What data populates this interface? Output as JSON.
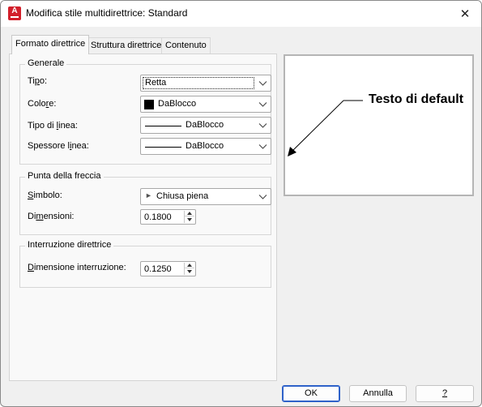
{
  "window": {
    "title": "Modifica stile multidirettrice: Standard",
    "app_icon_letter": "A",
    "close_glyph": "✕"
  },
  "tabs": [
    {
      "label": "Formato direttrice",
      "active": true
    },
    {
      "label": "Struttura direttrice",
      "active": false
    },
    {
      "label": "Contenuto",
      "active": false
    }
  ],
  "generale": {
    "title": "Generale",
    "tipo": {
      "label_pre": "Ti",
      "label_u": "p",
      "label_post": "o:",
      "value": "Retta"
    },
    "colore": {
      "label_pre": "Colo",
      "label_u": "r",
      "label_post": "e:",
      "value": "DaBlocco",
      "swatch_color": "#000000"
    },
    "tipo_linea": {
      "label_pre": "Tipo di ",
      "label_u": "l",
      "label_post": "inea:",
      "value": "DaBlocco"
    },
    "spessore_linea": {
      "label_pre": "Spessore l",
      "label_u": "i",
      "label_post": "nea:",
      "value": "DaBlocco"
    }
  },
  "punta": {
    "title": "Punta della freccia",
    "simbolo": {
      "label_pre": "",
      "label_u": "S",
      "label_post": "imbolo:",
      "value": "Chiusa piena",
      "glyph": "►"
    },
    "dimensioni": {
      "label_pre": "Di",
      "label_u": "m",
      "label_post": "ensioni:",
      "value": "0.1800"
    }
  },
  "interruzione": {
    "title": "Interruzione direttrice",
    "dimensione": {
      "label_pre": "",
      "label_u": "D",
      "label_post": "imensione interruzione:",
      "value": "0.1250"
    }
  },
  "preview": {
    "text": "Testo di default"
  },
  "buttons": {
    "ok": "OK",
    "annulla": "Annulla",
    "help": "?"
  },
  "colors": {
    "accent": "#2f62c9",
    "app_icon": "#d21f2a"
  }
}
